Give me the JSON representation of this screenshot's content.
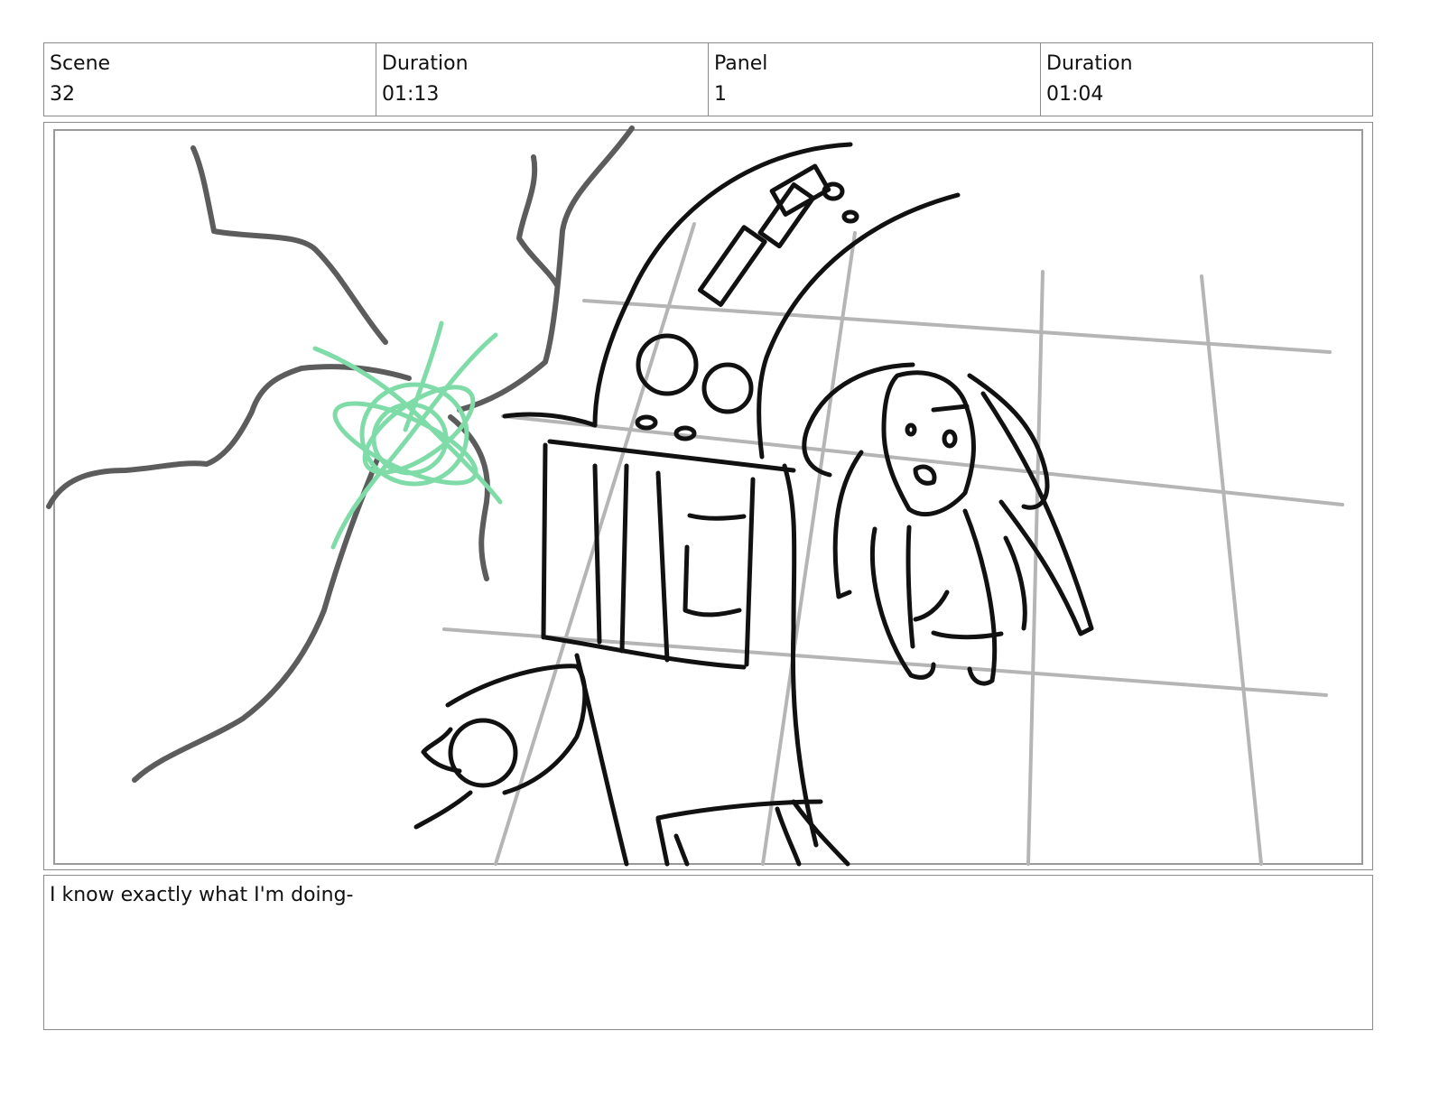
{
  "header": {
    "scene": {
      "label": "Scene",
      "value": "32"
    },
    "scene_duration": {
      "label": "Duration",
      "value": "01:13"
    },
    "panel": {
      "label": "Panel",
      "value": "1"
    },
    "panel_duration": {
      "label": "Duration",
      "value": "01:04"
    }
  },
  "dialogue": {
    "text": "I know exactly what I'm doing-"
  },
  "colors": {
    "border": "#8a8a8a",
    "sketch": "#111111",
    "grid": "#b5b5b5",
    "crack": "#5c5c5c",
    "magic": "#7fdca8"
  }
}
